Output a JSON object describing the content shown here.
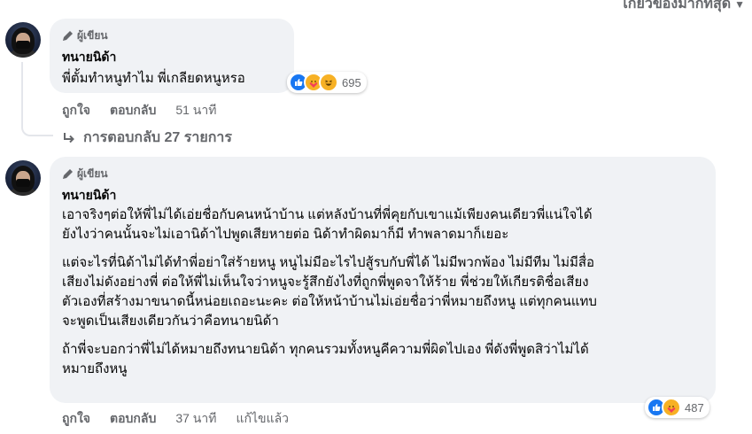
{
  "sort": {
    "label": "เกี่ยวข้องมากที่สุด"
  },
  "comments": [
    {
      "badge": "ผู้เขียน",
      "author": "ทนายนิด้า",
      "lines": [
        "พี่ตั้มทำหนูทำไม พี่เกลียดหนูหรอ"
      ],
      "reaction_count": "695",
      "reactions": [
        "like-icon",
        "care-icon",
        "haha-icon"
      ],
      "actions": {
        "like": "ถูกใจ",
        "reply": "ตอบกลับ",
        "time": "51 นาที"
      },
      "replies_label": "การตอบกลับ 27 รายการ"
    },
    {
      "badge": "ผู้เขียน",
      "author": "ทนายนิด้า",
      "paragraphs": [
        [
          "เอาจริงๆต่อให้พี่ไม่ได้เอ่ยชื่อกับคนหน้าบ้าน แต่หลังบ้านที่พี่คุยกับเขาแม้เพียงคนเดียวพี่แน่ใจได้",
          "ยังไงว่าคนนั้นจะไม่เอานิด้าไปพูดเสียหายต่อ นิด้าทำผิดมาก็มี ทำพลาดมาก็เยอะ"
        ],
        [
          "แต่จะไรที่นิด้าไม่ได้ทำพี่อย่าใส่ร้ายหนู หนูไม่มีอะไรไปสู้รบกับพี่ได้ ไม่มีพวกพ้อง ไม่มีทีม ไม่มีสื่อ",
          "เสียงไม่ดังอย่างพี่ ต่อให้พี่ไม่เห็นใจว่าหนูจะรู้สึกยังไงที่ถูกพี่พูดจาให้ร้าย พี่ช่วยให้เกียรติชื่อเสียง",
          "ตัวเองที่สร้างมาขนาดนี้หน่อยเถอะนะคะ ต่อให้หน้าบ้านไม่เอ่ยชื่อว่าพี่หมายถึงหนู แต่ทุกคนแทบ",
          "จะพูดเป็นเสียงเดียวกันว่าคือทนายนิด้า"
        ],
        [
          "ถ้าพี่จะบอกว่าพี่ไม่ได้หมายถึงทนายนิด้า ทุกคนรวมทั้งหนูคีความพี่ผิดไปเอง พี่ดังพี่พูดสิว่าไม่ได้",
          "หมายถึงหนู"
        ]
      ],
      "reaction_count": "487",
      "reactions": [
        "like-icon",
        "care-icon"
      ],
      "actions": {
        "like": "ถูกใจ",
        "reply": "ตอบกลับ",
        "time": "37 นาที",
        "edited": "แก้ไขแล้ว"
      }
    }
  ]
}
